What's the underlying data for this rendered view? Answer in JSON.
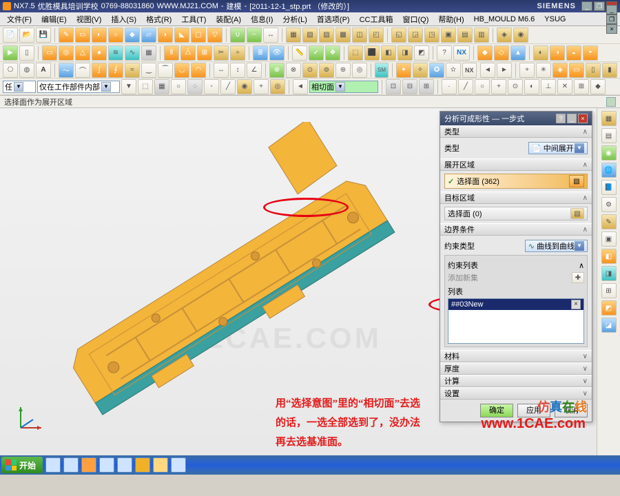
{
  "title": {
    "app": "NX7.5",
    "school": "优胜模具培训学校",
    "phone": "0769-88031860",
    "site": "WWW.MJ21.COM",
    "mode": "建模",
    "doc": "[2011-12-1_stp.prt （修改的）]",
    "brand": "SIEMENS"
  },
  "menu": [
    "文件(F)",
    "编辑(E)",
    "视图(V)",
    "插入(S)",
    "格式(R)",
    "工具(T)",
    "装配(A)",
    "信息(I)",
    "分析(L)",
    "首选项(P)",
    "CC工具箱",
    "窗口(Q)",
    "帮助(H)",
    "HB_MOULD M6.6",
    "YSUG"
  ],
  "selectionBar": {
    "scope_left": "任",
    "scope": "仅在工作部件内部",
    "intent": "相切面"
  },
  "status": "选择面作为展开区域",
  "annotation": "用“选择意图”里的“相切面”去选的话，一选全部选到了，没办法再去选基准面。",
  "panel": {
    "title": "分析可成形性 — 一步式",
    "section_type": "类型",
    "type_label": "类型",
    "type_value": "中间展开",
    "section_unfold": "展开区域",
    "select_face": "选择面 (362)",
    "section_target": "目标区域",
    "target_face": "选择面 (0)",
    "section_boundary": "边界条件",
    "constraint_type": "约束类型",
    "constraint_value": "曲线到曲线",
    "constraint_list": "约束列表",
    "add_new": "添加新集",
    "list": "列表",
    "list_item": "##03New",
    "sec_material": "材料",
    "sec_thickness": "厚度",
    "sec_calc": "计算",
    "sec_settings": "设置",
    "ok": "确定",
    "apply": "应用",
    "cancel": "取消"
  },
  "taskbar": {
    "start": "开始"
  },
  "watermark": "www.1CAE.com",
  "brandmark": [
    "仿",
    "真",
    "在",
    "线"
  ],
  "bg_watermark": "1CAE.COM"
}
